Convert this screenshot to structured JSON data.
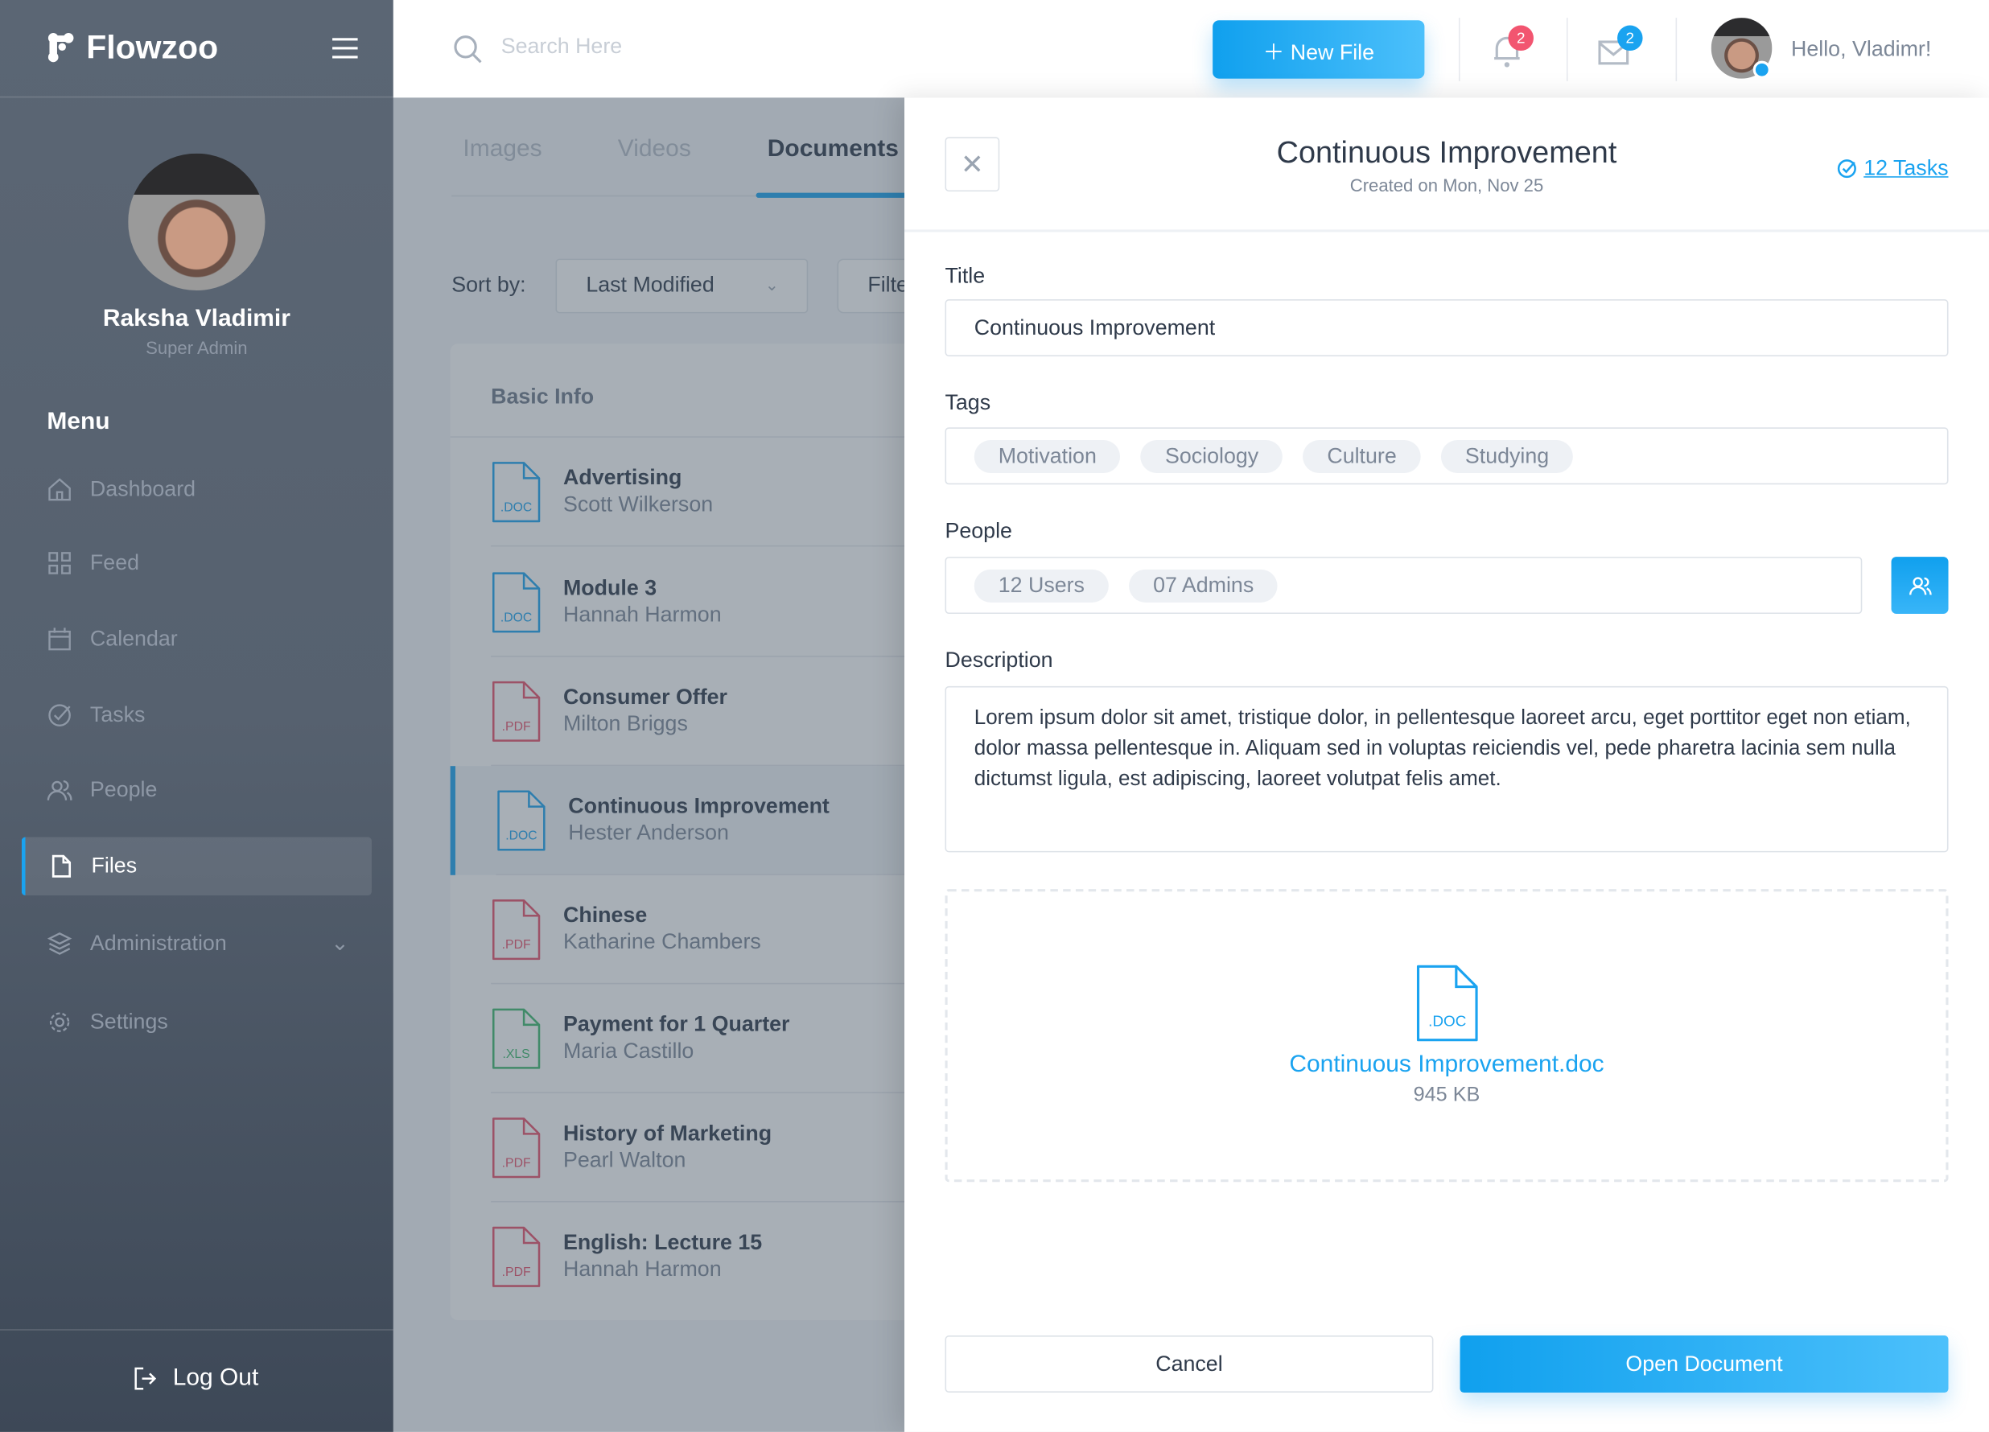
{
  "app": {
    "name": "Flowzoo"
  },
  "user": {
    "name": "Raksha Vladimir",
    "role": "Super Admin",
    "greeting": "Hello, Vladimr!"
  },
  "sidebar": {
    "menu_heading": "Menu",
    "items": [
      {
        "label": "Dashboard",
        "icon": "home-icon"
      },
      {
        "label": "Feed",
        "icon": "grid-icon"
      },
      {
        "label": "Calendar",
        "icon": "calendar-icon"
      },
      {
        "label": "Tasks",
        "icon": "check-circle-icon"
      },
      {
        "label": "People",
        "icon": "people-icon"
      },
      {
        "label": "Files",
        "icon": "file-icon",
        "active": true
      },
      {
        "label": "Administration",
        "icon": "layers-icon"
      },
      {
        "label": "Settings",
        "icon": "gear-icon"
      }
    ],
    "logout": "Log Out"
  },
  "header": {
    "search_placeholder": "Search Here",
    "new_file": "New File",
    "notifications_count": "2",
    "messages_count": "2"
  },
  "main": {
    "tabs": [
      "Images",
      "Videos",
      "Documents"
    ],
    "active_tab": "Documents",
    "sort_label": "Sort by:",
    "sort_value": "Last Modified",
    "filter_label": "Filter",
    "card_heading": "Basic Info",
    "files": [
      {
        "title": "Advertising",
        "author": "Scott Wilkerson",
        "type": ".DOC"
      },
      {
        "title": "Module 3",
        "author": "Hannah Harmon",
        "type": ".DOC"
      },
      {
        "title": "Consumer Offer",
        "author": "Milton Briggs",
        "type": ".PDF"
      },
      {
        "title": "Continuous Improvement",
        "author": "Hester Anderson",
        "type": ".DOC"
      },
      {
        "title": "Chinese",
        "author": "Katharine Chambers",
        "type": ".PDF"
      },
      {
        "title": "Payment for 1 Quarter",
        "author": "Maria Castillo",
        "type": ".XLS"
      },
      {
        "title": "History of Marketing",
        "author": "Pearl Walton",
        "type": ".PDF"
      },
      {
        "title": "English: Lecture 15",
        "author": "Hannah Harmon",
        "type": ".PDF"
      }
    ]
  },
  "panel": {
    "title": "Continuous Improvement",
    "created": "Created on Mon, Nov 25",
    "tasks": "12 Tasks",
    "title_label": "Title",
    "title_value": "Continuous Improvement",
    "tags_label": "Tags",
    "tags": [
      "Motivation",
      "Sociology",
      "Culture",
      "Studying"
    ],
    "people_label": "People",
    "people": [
      "12 Users",
      "07 Admins"
    ],
    "description_label": "Description",
    "description": "Lorem ipsum dolor sit amet, tristique dolor, in pellentesque laoreet arcu, eget porttitor eget non etiam, dolor massa pellentesque in. Aliquam sed in voluptas reiciendis vel, pede pharetra lacinia sem nulla dictumst ligula, est adipiscing, laoreet volutpat felis amet.",
    "attachment": {
      "name": "Continuous Improvement.doc",
      "size": "945 KB",
      "type": ".DOC"
    },
    "cancel": "Cancel",
    "open": "Open Document"
  },
  "colors": {
    "accent": "#1aa3f0",
    "doc": "#1aa3f0",
    "pdf": "#e8506a",
    "xls": "#3dba6f",
    "badge_red": "#f25570"
  }
}
